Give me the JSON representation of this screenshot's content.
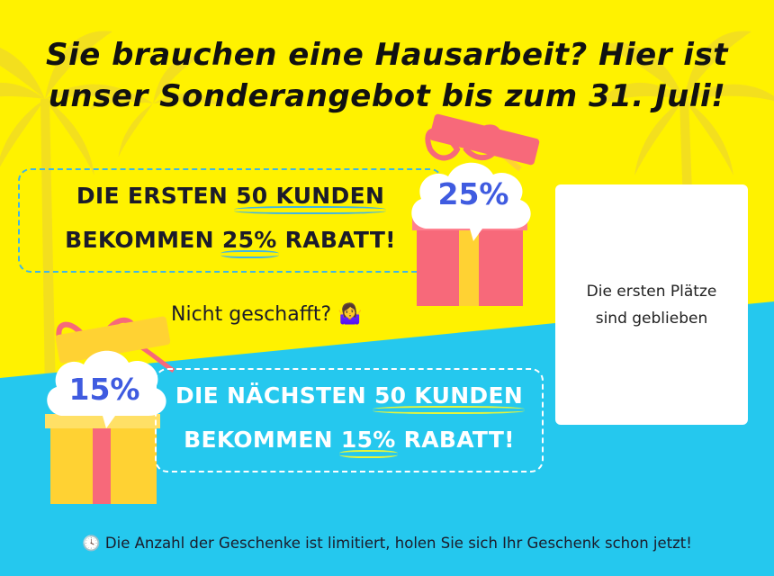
{
  "headline": {
    "line1": "Sie brauchen eine Hausarbeit? Hier ist",
    "line2": "unser Sonderangebot bis zum 31. Juli!"
  },
  "offer1": {
    "line1_prefix": "DIE ERSTEN ",
    "line1_highlight": "50 KUNDEN",
    "line2_prefix": "BEKOMMEN ",
    "line2_highlight": "25%",
    "line2_suffix": " RABATT!",
    "badge": "25%"
  },
  "middle": {
    "text": "Nicht geschafft? 🤷‍♀️"
  },
  "offer2": {
    "line1_prefix": "DIE NÄCHSTEN ",
    "line1_highlight": "50 KUNDEN",
    "line2_prefix": "BEKOMMEN ",
    "line2_highlight": "15%",
    "line2_suffix": " RABATT!",
    "badge": "15%"
  },
  "side_card": {
    "line1": "Die ersten Plätze",
    "line2": "sind geblieben"
  },
  "footer": {
    "icon": "clock-icon",
    "glyph": "🕓",
    "text": " Die Anzahl der Geschenke ist limitiert, holen Sie sich Ihr Geschenk schon jetzt!"
  },
  "colors": {
    "yellow": "#fff200",
    "cyan": "#25c8ee",
    "badge_text": "#3f5be0",
    "gift_pink": "#f7697a",
    "gift_yellow": "#ffd233"
  }
}
